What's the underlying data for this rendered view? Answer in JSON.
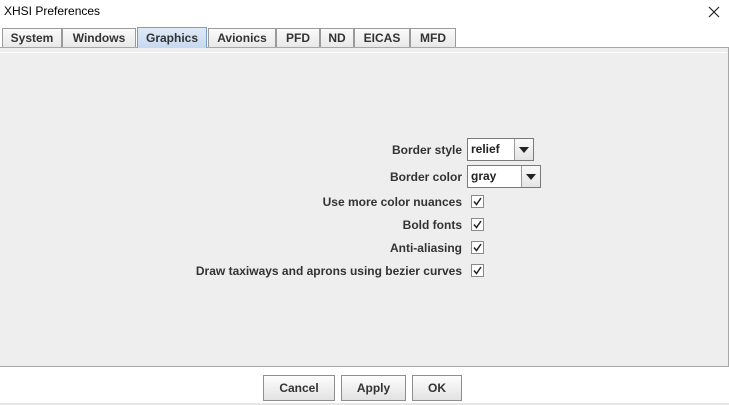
{
  "window": {
    "title": "XHSI Preferences",
    "close_icon": "close-icon"
  },
  "tabs": [
    {
      "label": "System",
      "active": false
    },
    {
      "label": "Windows",
      "active": false
    },
    {
      "label": "Graphics",
      "active": true
    },
    {
      "label": "Avionics",
      "active": false
    },
    {
      "label": "PFD",
      "active": false
    },
    {
      "label": "ND",
      "active": false
    },
    {
      "label": "EICAS",
      "active": false
    },
    {
      "label": "MFD",
      "active": false
    }
  ],
  "graphics": {
    "border_style": {
      "label": "Border style",
      "value": "relief"
    },
    "border_color": {
      "label": "Border color",
      "value": "gray"
    },
    "color_nuances": {
      "label": "Use more color nuances",
      "checked": true
    },
    "bold_fonts": {
      "label": "Bold fonts",
      "checked": true
    },
    "anti_aliasing": {
      "label": "Anti-aliasing",
      "checked": true
    },
    "bezier_curves": {
      "label": "Draw taxiways and aprons using bezier curves",
      "checked": true
    }
  },
  "buttons": {
    "cancel": "Cancel",
    "apply": "Apply",
    "ok": "OK"
  },
  "colors": {
    "active_tab": "#c6d9ef",
    "panel_bg": "#eeeeee"
  }
}
